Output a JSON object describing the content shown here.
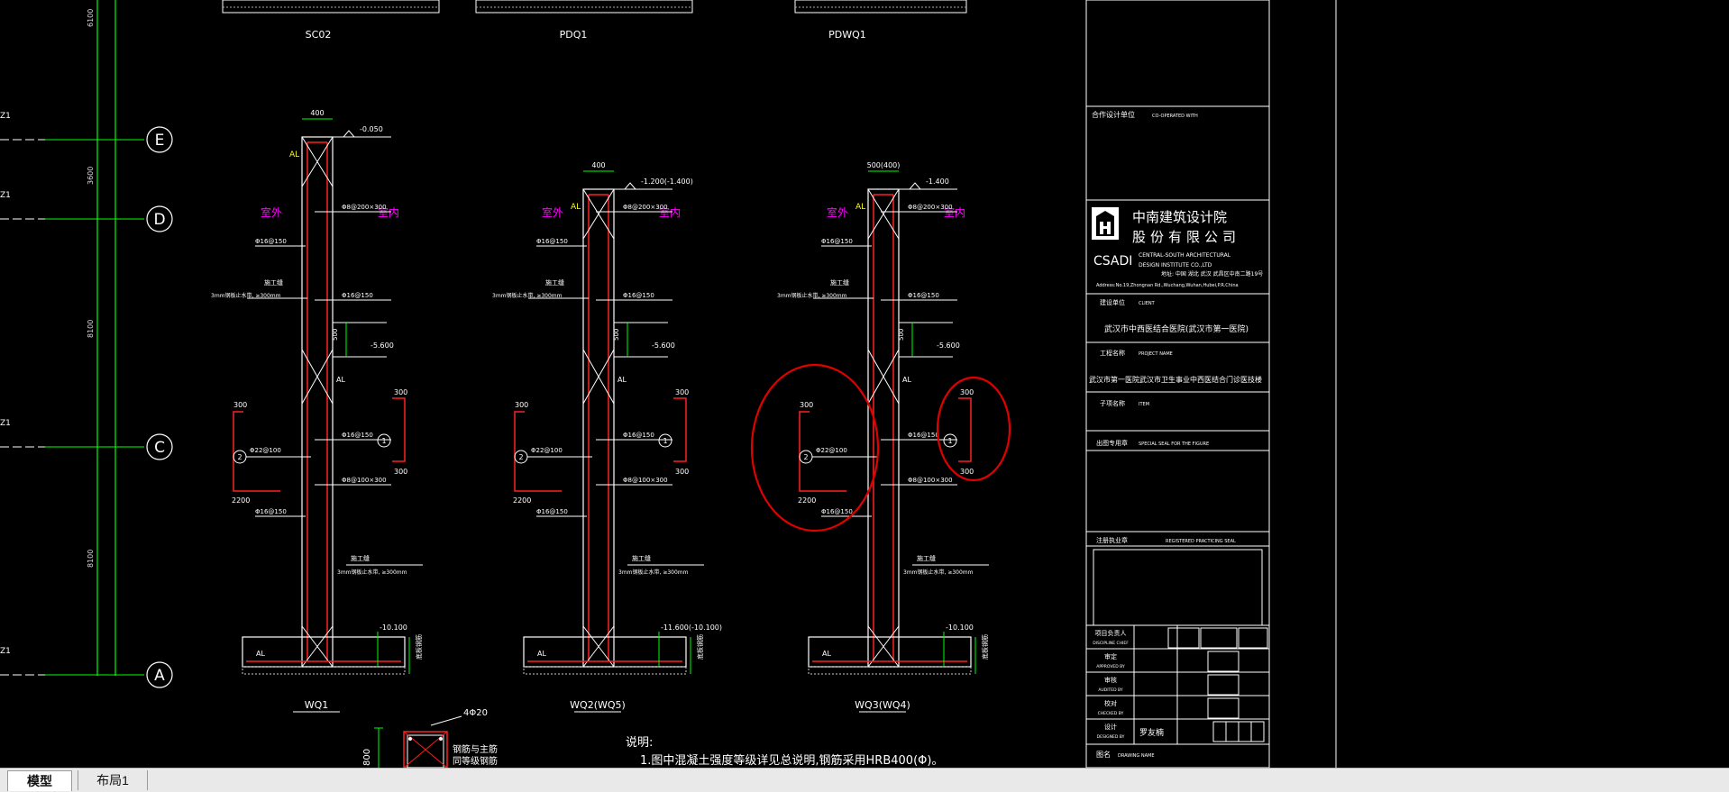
{
  "axes": [
    {
      "label": "E",
      "left_tick": "Z1"
    },
    {
      "label": "D",
      "left_tick": "Z1"
    },
    {
      "label": "C",
      "left_tick": "Z1"
    },
    {
      "label": "A",
      "left_tick": "Z1"
    }
  ],
  "dims_vertical": [
    "6100",
    "3600",
    "8100",
    "8100"
  ],
  "top_labels": [
    "SC02",
    "PDQ1",
    "PDWQ1"
  ],
  "sections": [
    {
      "name": "WQ1",
      "width_dim": "400",
      "top_elev": "-0.050",
      "mid_elev": "-5.600",
      "bot_elev": "-10.100",
      "outside": "室外",
      "inside": "室内",
      "ann": [
        "Φ8@200×300",
        "Φ16@150",
        "Φ16@150",
        "Φ16@150",
        "Φ8@100×300",
        "Φ16@150"
      ],
      "left_rebar": "Φ22@100",
      "left_dims": [
        "300",
        "2200"
      ],
      "right_dims": [
        "300",
        "300"
      ],
      "joint": "施工缝",
      "joint_note": "3mm钢板止水带, ≥300mm",
      "al": "AL",
      "dim_500": "500",
      "mark1": "1",
      "mark2": "2"
    },
    {
      "name": "WQ2(WQ5)",
      "width_dim": "400",
      "top_elev": "-1.200(-1.400)",
      "mid_elev": "-5.600",
      "bot_elev": "-11.600(-10.100)",
      "outside": "室外",
      "inside": "室内",
      "ann": [
        "Φ8@200×300",
        "Φ16@150",
        "Φ16@150",
        "Φ16@150",
        "Φ8@100×300",
        "Φ16@150"
      ],
      "left_rebar": "Φ22@100",
      "left_dims": [
        "300",
        "2200"
      ],
      "right_dims": [
        "300",
        "300"
      ],
      "joint": "施工缝",
      "joint_note": "3mm钢板止水带, ≥300mm",
      "al": "AL",
      "dim_500": "500",
      "mark1": "1",
      "mark2": "2"
    },
    {
      "name": "WQ3(WQ4)",
      "width_dim": "500(400)",
      "top_elev": "-1.400",
      "mid_elev": "-5.600",
      "bot_elev": "-10.100",
      "outside": "室外",
      "inside": "室内",
      "ann": [
        "Φ8@200×300",
        "Φ16@150",
        "Φ16@150",
        "Φ16@150",
        "Φ8@100×300",
        "Φ16@150"
      ],
      "left_rebar": "Φ22@100",
      "left_dims": [
        "300",
        "2200"
      ],
      "right_dims": [
        "300",
        "300"
      ],
      "joint": "施工缝",
      "joint_note": "3mm钢板止水带, ≥300mm",
      "al": "AL",
      "dim_500": "500",
      "mark1": "1",
      "mark2": "2"
    }
  ],
  "side_label": "底板钢筋",
  "bottom": {
    "note_title": "说明:",
    "note_1": "1.图中混凝土强度等级详见总说明,钢筋采用HRB400(Φ)。",
    "bar_label": "4Φ20",
    "sub_label_1": "钢筋与主筋",
    "sub_label_2": "同等级钢筋",
    "dim": "800"
  },
  "title_block": {
    "cooperation_label": "合作设计单位",
    "cooperation_en": "CO-OPERATED WITH",
    "company_cn_1": "中南建筑设计院",
    "company_cn_2": "股份有限公司",
    "company_abbr": "CSADI",
    "company_en_1": "CENTRAL-SOUTH ARCHITECTURAL",
    "company_en_2": "DESIGN INSTITUTE CO.,LTD",
    "address_cn": "地址: 中国 湖北 武汉 武昌区中南二路19号",
    "address_en": "Address:No.19,Zhongnan Rd.,Wuchang,Wuhan,Hubei,P.R.China",
    "client_label": "建设单位",
    "client_en": "CLIENT",
    "client_value": "武汉市中西医结合医院(武汉市第一医院)",
    "project_label": "工程名称",
    "project_en": "PROJECT NAME",
    "project_value": "武汉市第一医院武汉市卫生事业中西医结合门诊医技楼",
    "sub_label": "子项名称",
    "sub_en": "ITEM",
    "seal_label": "出图专用章",
    "seal_en": "SPECIAL SEAL FOR THE FIGURE",
    "reg_label": "注册执业章",
    "reg_en": "REGISTERED PRACTICING SEAL",
    "rows": [
      {
        "cn": "项目负责人",
        "en": "DISCIPLINE CHIEF"
      },
      {
        "cn": "审定",
        "en": "APPROVED BY"
      },
      {
        "cn": "审核",
        "en": "AUDITED BY"
      },
      {
        "cn": "校对",
        "en": "CHECKED BY"
      },
      {
        "cn": "设计",
        "en": "DESIGNED BY"
      }
    ],
    "designer_sign": "罗友楠",
    "drawing_label": "图名",
    "drawing_en": "DRAWING NAME"
  },
  "tabs": [
    {
      "label": "模型",
      "active": true
    },
    {
      "label": "布局1",
      "active": false
    }
  ],
  "colors": {
    "background": "#000000",
    "line_white": "#ffffff",
    "green": "#00ff00",
    "red": "#ff2020",
    "magenta": "#ff00ff",
    "yellow": "#ffff00",
    "annotation_circle": "#e00000"
  }
}
